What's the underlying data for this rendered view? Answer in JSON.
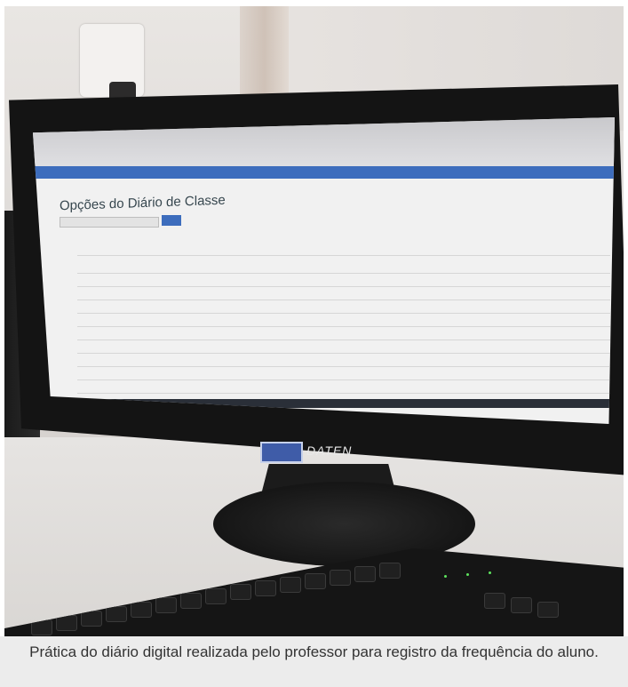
{
  "photo": {
    "screen_app_title": "Opções do Diário de Classe",
    "monitor_brand": "DATEN",
    "keyboard_brand": "DATEN"
  },
  "caption": "Prática do diário digital realizada pelo professor para registro da frequência do aluno."
}
